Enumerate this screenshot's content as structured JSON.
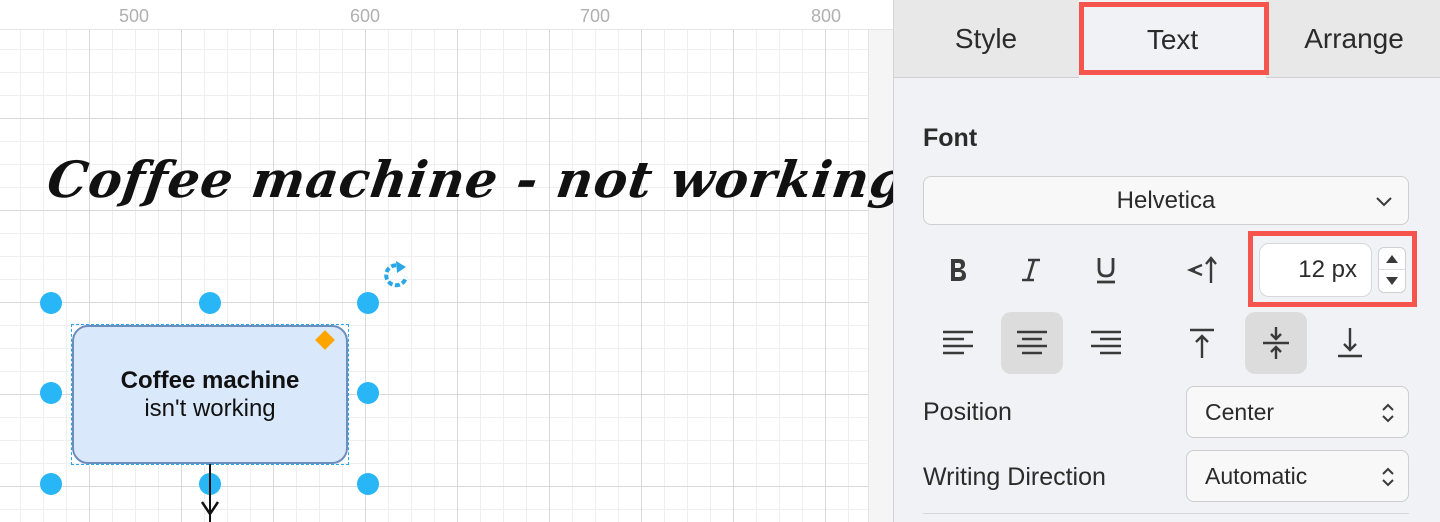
{
  "ruler": {
    "labels": [
      "500",
      "600",
      "700",
      "800"
    ]
  },
  "diagram": {
    "handwritten_title": "Coffee machine - not working",
    "shape": {
      "line1": "Coffee machine",
      "line2": "isn't working"
    }
  },
  "panel": {
    "tabs": {
      "style": "Style",
      "text": "Text",
      "arrange": "Arrange",
      "active": "Text"
    },
    "font_section_label": "Font",
    "font_family": "Helvetica",
    "font_size": "12 px",
    "position_label": "Position",
    "position_value": "Center",
    "writing_direction_label": "Writing Direction",
    "writing_direction_value": "Automatic"
  },
  "icons": {
    "bold": "bold-icon",
    "italic": "italic-icon",
    "underline": "underline-icon",
    "vertical_text": "vertical-text-icon",
    "align_left": "align-left-icon",
    "align_center": "align-center-icon",
    "align_right": "align-right-icon",
    "vertical_top": "align-top-icon",
    "vertical_middle": "align-middle-icon",
    "vertical_bottom": "align-bottom-icon"
  },
  "colors": {
    "selection_handle": "#29b6f6",
    "shape_fill": "#dae8fc",
    "shape_stroke": "#6c8ebf",
    "highlight": "#f5554d",
    "diamond": "#ffa500"
  }
}
